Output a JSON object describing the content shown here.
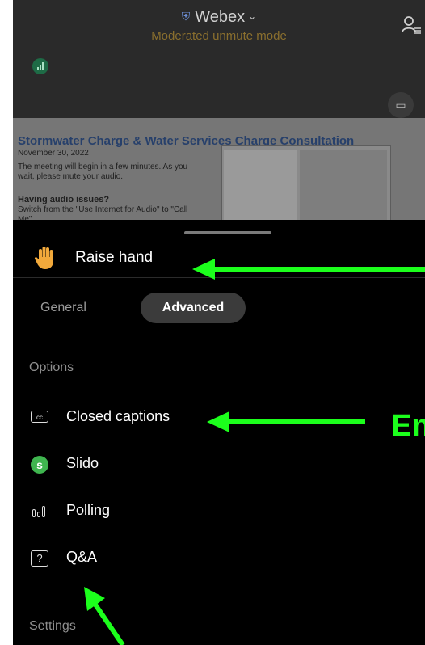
{
  "header": {
    "app_name": "Webex",
    "mode": "Moderated unmute mode"
  },
  "slide": {
    "title": "Stormwater Charge & Water Services Charge Consultation",
    "date": "November 30, 2022",
    "text": "The meeting will begin in a few minutes. As you wait, please mute your audio.",
    "heading": "Having audio issues?",
    "text2": "Switch from the \"Use Internet for Audio\" to \"Call Me\""
  },
  "sheet": {
    "raise_hand": "Raise hand",
    "tabs": {
      "general": "General",
      "advanced": "Advanced",
      "selected": "Advanced"
    },
    "options_label": "Options",
    "options": [
      {
        "label": "Closed captions",
        "icon": "closed-captions-icon"
      },
      {
        "label": "Slido",
        "icon": "slido-icon"
      },
      {
        "label": "Polling",
        "icon": "polling-icon"
      },
      {
        "label": "Q&A",
        "icon": "qa-icon"
      }
    ],
    "settings_label": "Settings"
  },
  "annotation": {
    "text": "En",
    "color": "#1cff1c"
  },
  "colors": {
    "accent": "#1cff1c",
    "sheet_bg": "#000000",
    "tab_selected_bg": "#3b3b3b",
    "slido": "#3fb54f",
    "mode_text": "#8a6f2e"
  }
}
